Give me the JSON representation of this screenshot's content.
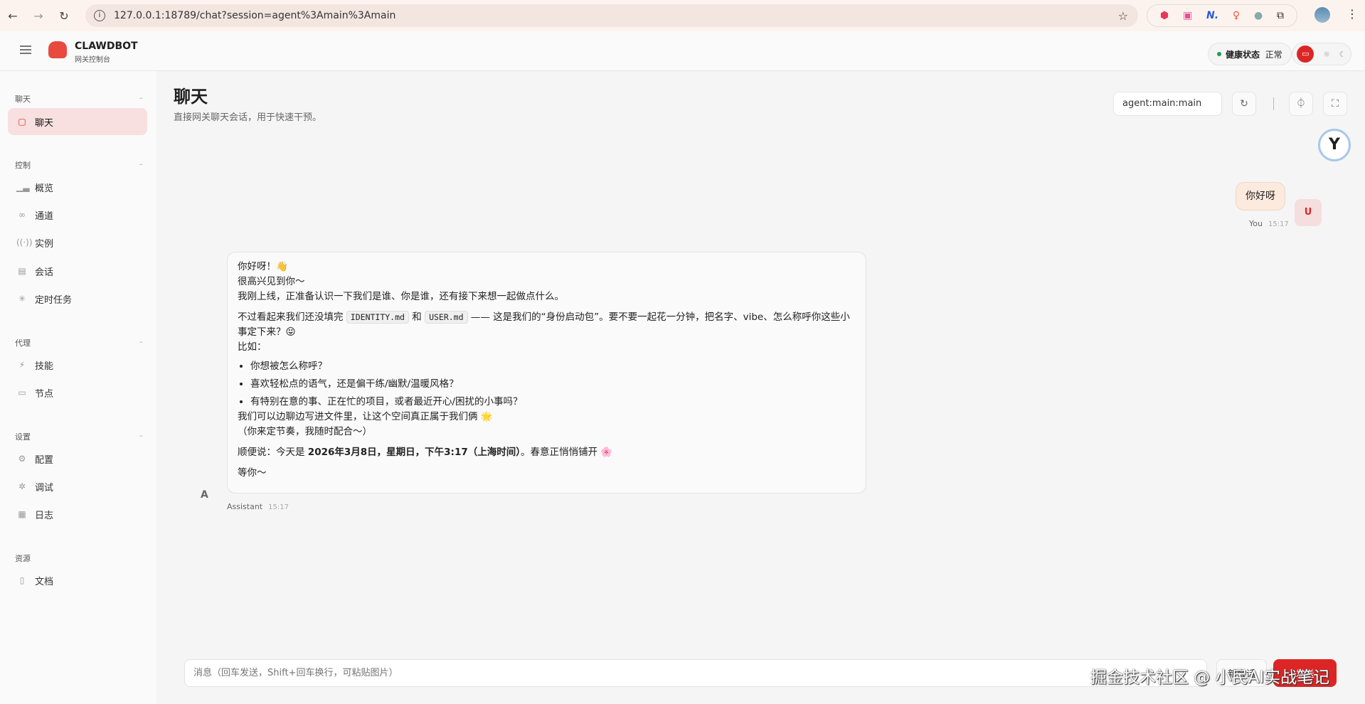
{
  "browser": {
    "url": "127.0.0.1:18789/chat?session=agent%3Amain%3Amain"
  },
  "header": {
    "brand": "CLAWDBOT",
    "brand_sub": "网关控制台",
    "health_label": "健康状态",
    "health_value": "正常",
    "health_color": "#1aa052",
    "accent": "#dc2626"
  },
  "sidebar": {
    "sections": [
      {
        "label": "聊天",
        "items": [
          {
            "label": "聊天",
            "icon": "message-icon",
            "active": true
          }
        ]
      },
      {
        "label": "控制",
        "items": [
          {
            "label": "概览",
            "icon": "bar-chart-icon"
          },
          {
            "label": "通道",
            "icon": "link-icon"
          },
          {
            "label": "实例",
            "icon": "broadcast-icon"
          },
          {
            "label": "会话",
            "icon": "file-icon"
          },
          {
            "label": "定时任务",
            "icon": "loader-icon"
          }
        ]
      },
      {
        "label": "代理",
        "items": [
          {
            "label": "技能",
            "icon": "zap-icon"
          },
          {
            "label": "节点",
            "icon": "monitor-icon"
          }
        ]
      },
      {
        "label": "设置",
        "items": [
          {
            "label": "配置",
            "icon": "gear-icon"
          },
          {
            "label": "调试",
            "icon": "bug-icon"
          },
          {
            "label": "日志",
            "icon": "scroll-icon"
          }
        ]
      },
      {
        "label": "资源",
        "items": [
          {
            "label": "文档",
            "icon": "book-icon"
          }
        ]
      }
    ]
  },
  "main": {
    "title": "聊天",
    "subtitle": "直接网关聊天会话，用于快速干预。",
    "session": "agent:main:main"
  },
  "messages": {
    "user": {
      "text": "你好呀",
      "avatar": "U",
      "sender": "You",
      "time": "15:17"
    },
    "assistant": {
      "avatar": "A",
      "sender": "Assistant",
      "time": "15:17",
      "l1": "你好呀！👋",
      "l2": "很高兴见到你～",
      "l3": "我刚上线，正准备认识一下我们是谁、你是谁，还有接下来想一起做点什么。",
      "p2a": "不过看起来我们还没填完",
      "code1": "IDENTITY.md",
      "p2b": "和",
      "code2": "USER.md",
      "p2c": "—— 这是我们的“身份启动包”。要不要一起花一分钟，把名字、vibe、怎么称呼你这些小事定下来？😝",
      "p2d": "比如：",
      "bullets": [
        "你想被怎么称呼？",
        "喜欢轻松点的语气，还是偏干练/幽默/温暖风格？",
        "有特别在意的事、正在忙的项目，或者最近开心/困扰的小事吗？"
      ],
      "p3a": "我们可以边聊边写进文件里，让这个空间真正属于我们俩 🌟",
      "p3b": "（你来定节奏，我随时配合～）",
      "p4a": "顺便说：今天是 ",
      "p4b": "2026年3月8日，星期日，下午3:17（上海时间）",
      "p4c": "。春意正悄悄铺开 🌸",
      "p5": "等你～"
    }
  },
  "composer": {
    "placeholder": "消息（回车发送，Shift+回车换行，可粘贴图片）",
    "new_label": "新会话",
    "send_label": "发送"
  },
  "watermark": "掘金技术社区 @ 小民AI实战笔记"
}
